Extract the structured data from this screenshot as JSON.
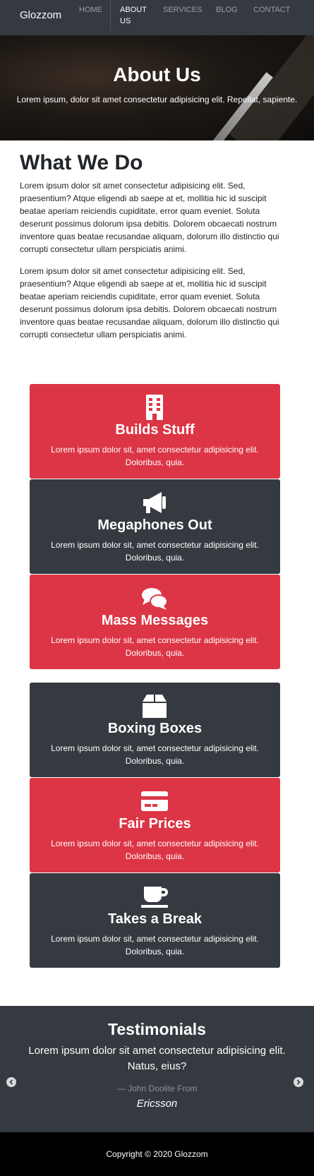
{
  "nav": {
    "brand": "Glozzom",
    "items": [
      {
        "label": "HOME",
        "active": false
      },
      {
        "label": "ABOUT US",
        "active": true
      },
      {
        "label": "SERVICES",
        "active": false
      },
      {
        "label": "BLOG",
        "active": false
      },
      {
        "label": "CONTACT",
        "active": false
      }
    ]
  },
  "hero": {
    "title": "About Us",
    "subtitle": "Lorem ipsum, dolor sit amet consectetur adipisicing elit. Repellat, sapiente."
  },
  "about": {
    "title": "What We Do",
    "paragraphs": [
      "Lorem ipsum dolor sit amet consectetur adipisicing elit. Sed, praesentium? Atque eligendi ab saepe at et, mollitia hic id suscipit beatae aperiam reiciendis cupiditate, error quam eveniet. Soluta deserunt possimus dolorum ipsa debitis. Dolorem obcaecati nostrum inventore quas beatae recusandae aliquam, dolorum illo distinctio qui corrupti consectetur ullam perspiciatis animi.",
      "Lorem ipsum dolor sit amet consectetur adipisicing elit. Sed, praesentium? Atque eligendi ab saepe at et, mollitia hic id suscipit beatae aperiam reiciendis cupiditate, error quam eveniet. Soluta deserunt possimus dolorum ipsa debitis. Dolorem obcaecati nostrum inventore quas beatae recusandae aliquam, dolorum illo distinctio qui corrupti consectetur ullam perspiciatis animi."
    ]
  },
  "features": [
    {
      "icon": "building-icon",
      "title": "Builds Stuff",
      "text": "Lorem ipsum dolor sit, amet consectetur adipisicing elit. Doloribus, quia.",
      "color": "#dc3545"
    },
    {
      "icon": "megaphone-icon",
      "title": "Megaphones Out",
      "text": "Lorem ipsum dolor sit, amet consectetur adipisicing elit. Doloribus, quia.",
      "color": "#343a40"
    },
    {
      "icon": "comments-icon",
      "title": "Mass Messages",
      "text": "Lorem ipsum dolor sit, amet consectetur adipisicing elit. Doloribus, quia.",
      "color": "#dc3545"
    },
    {
      "icon": "box-icon",
      "title": "Boxing Boxes",
      "text": "Lorem ipsum dolor sit, amet consectetur adipisicing elit. Doloribus, quia.",
      "color": "#343a40"
    },
    {
      "icon": "credit-card-icon",
      "title": "Fair Prices",
      "text": "Lorem ipsum dolor sit, amet consectetur adipisicing elit. Doloribus, quia.",
      "color": "#dc3545"
    },
    {
      "icon": "coffee-icon",
      "title": "Takes a Break",
      "text": "Lorem ipsum dolor sit, amet consectetur adipisicing elit. Doloribus, quia.",
      "color": "#343a40"
    }
  ],
  "testimonials": {
    "title": "Testimonials",
    "quote": "Lorem ipsum dolor sit amet consectetur adipisicing elit. Natus, eius?",
    "from": "— John Doolite From",
    "company": "Ericsson"
  },
  "footer": {
    "copyright": "Copyright © 2020 Glozzom"
  },
  "colors": {
    "primary": "#dc3545",
    "dark": "#343a40",
    "footer": "#000000"
  }
}
